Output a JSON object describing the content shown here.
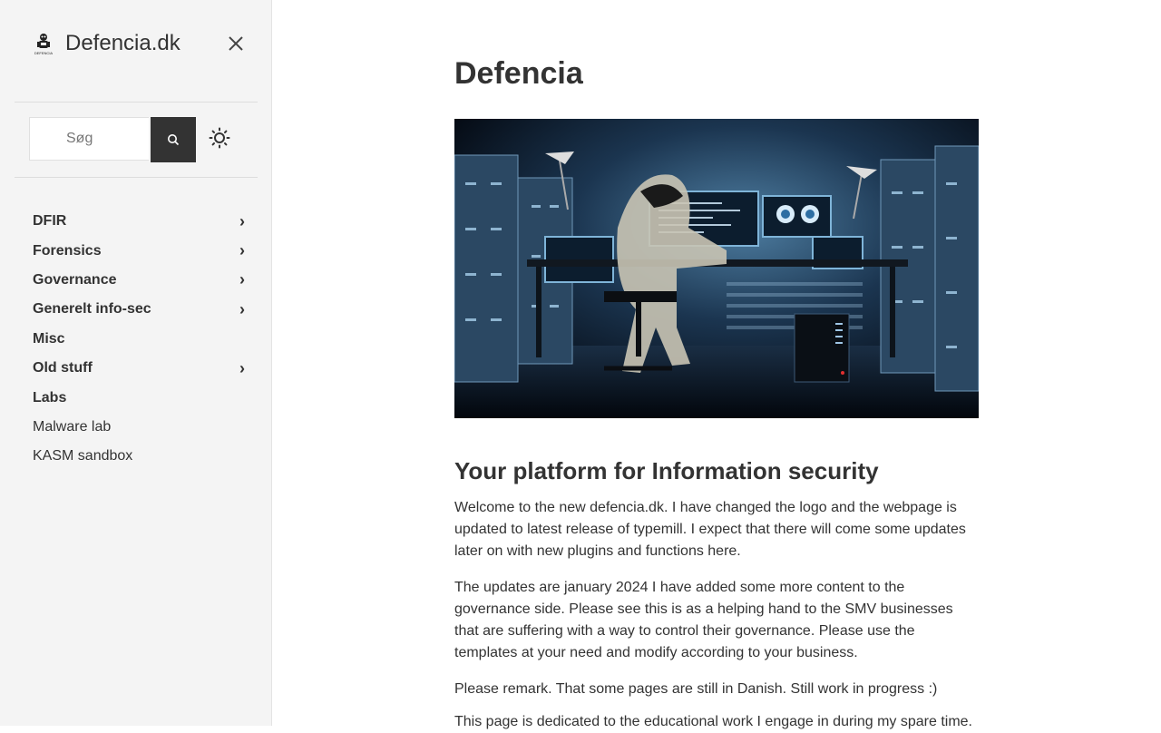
{
  "brand": {
    "name": "Defencia.dk",
    "logo_text": "DEFENCIA"
  },
  "search": {
    "placeholder": "Søg"
  },
  "icons": {
    "close": "close-icon",
    "search": "search-icon",
    "theme": "sun-icon",
    "chevron": "chevron-right-icon"
  },
  "nav": {
    "items": [
      {
        "label": "DFIR",
        "bold": true,
        "has_children": true
      },
      {
        "label": "Forensics",
        "bold": true,
        "has_children": true
      },
      {
        "label": "Governance",
        "bold": true,
        "has_children": true
      },
      {
        "label": "Generelt info-sec",
        "bold": true,
        "has_children": true
      },
      {
        "label": "Misc",
        "bold": true,
        "has_children": false
      },
      {
        "label": "Old stuff",
        "bold": true,
        "has_children": true
      },
      {
        "label": "Labs",
        "bold": true,
        "has_children": false
      },
      {
        "label": "Malware lab",
        "bold": false,
        "has_children": false
      },
      {
        "label": "KASM sandbox",
        "bold": false,
        "has_children": false
      }
    ]
  },
  "article": {
    "title": "Defencia",
    "subtitle": "Your platform for Information security",
    "paragraphs": [
      "Welcome to the new defencia.dk. I have changed the logo and the webpage is updated to latest release of typemill. I expect that there will come some updates later on with new plugins and functions here.",
      "The updates are january 2024 I have added some more content to the governance side. Please see this is as a helping hand to the SMV businesses that are suffering with a way to control their governance. Please use the templates at your need and modify according to your business.",
      "Please remark. That some pages are still in Danish. Still work in progress :)",
      "This page is dedicated to the educational work I engage in during my spare time."
    ]
  },
  "colors": {
    "sidebar_bg": "#f4f4f4",
    "text": "#333333",
    "search_button": "#333333"
  }
}
